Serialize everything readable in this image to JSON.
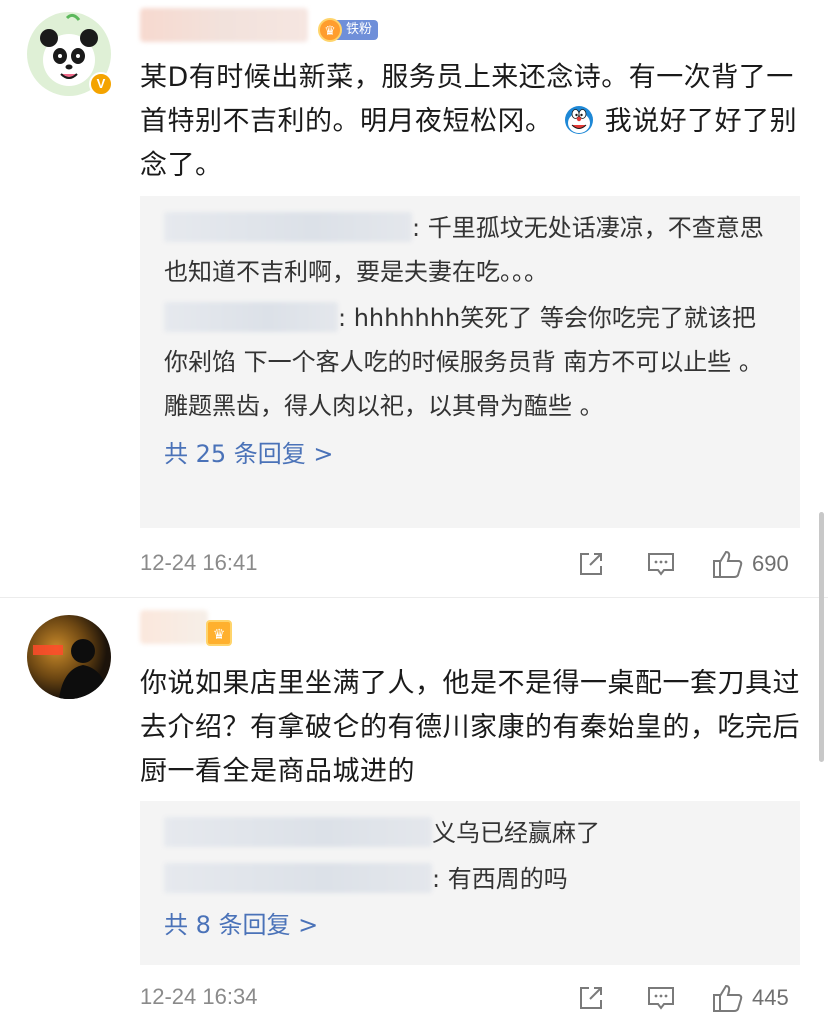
{
  "comments": [
    {
      "id": "comment-1",
      "avatar_icon": "panda-avatar-icon",
      "verified_badge": "V",
      "fan_badge_label": "铁粉",
      "text_parts": [
        "某D有时候出新菜，服务员上来还念诗。有一次背了一首特别不吉利的。明月夜短松冈。",
        "我说好了好了别念了。"
      ],
      "inline_emoji": "doraemon-emoji-icon",
      "replies": [
        {
          "text": ": 千里孤坟无处话凄凉，不查意思也知道不吉利啊，要是夫妻在吃。。。"
        },
        {
          "text": ": hhhhhhh笑死了  等会你吃完了就该把你剁馅 下一个客人吃的时候服务员背 南方不可以止些  。雕题黑齿，得人肉以祀，以其骨为醢些 。"
        }
      ],
      "more_replies": "共 25 条回复 >",
      "timestamp": "12-24 16:41",
      "like_count": "690"
    },
    {
      "id": "comment-2",
      "avatar_icon": "silhouette-avatar-icon",
      "text": "你说如果店里坐满了人，他是不是得一桌配一套刀具过去介绍？有拿破仑的有德川家康的有秦始皇的，吃完后厨一看全是商品城进的",
      "replies": [
        {
          "text": "义乌已经赢麻了"
        },
        {
          "text": ": 有西周的吗"
        }
      ],
      "more_replies": "共 8 条回复 >",
      "timestamp": "12-24 16:34",
      "like_count": "445"
    }
  ],
  "colors": {
    "link": "#4a72b8",
    "reply_bg": "#f4f4f4",
    "meta_text": "#8a8a8a",
    "fan_badge": "#6f8fd9",
    "crown": "#ff9d2e"
  }
}
